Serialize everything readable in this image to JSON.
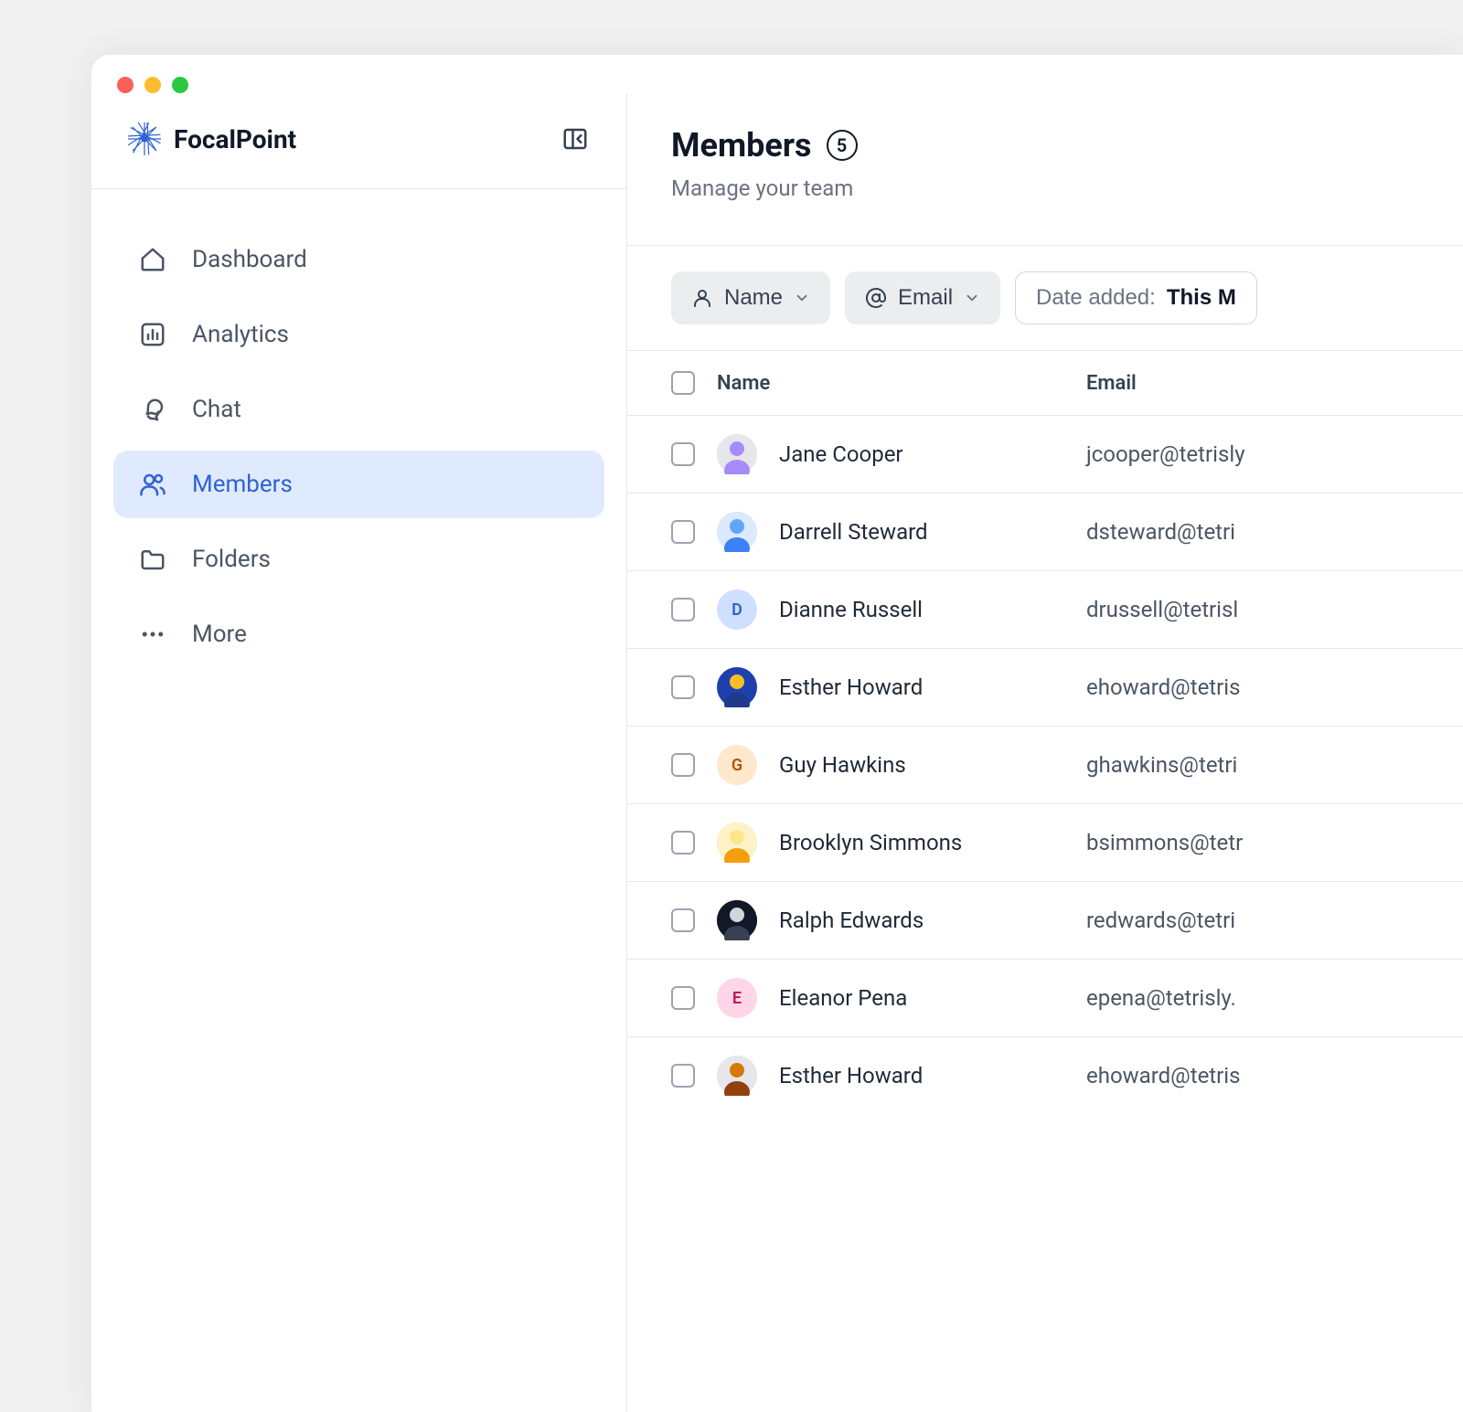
{
  "brand": {
    "name": "FocalPoint"
  },
  "sidebar": {
    "items": [
      {
        "label": "Dashboard"
      },
      {
        "label": "Analytics"
      },
      {
        "label": "Chat"
      },
      {
        "label": "Members"
      },
      {
        "label": "Folders"
      },
      {
        "label": "More"
      }
    ]
  },
  "page": {
    "title": "Members",
    "count": "5",
    "subtitle": "Manage your team"
  },
  "filters": {
    "name": "Name",
    "email": "Email",
    "date_label": "Date added: ",
    "date_value": "This M"
  },
  "columns": {
    "name": "Name",
    "email": "Email"
  },
  "members": [
    {
      "name": "Jane Cooper",
      "email": "jcooper@tetrisly",
      "initial": "",
      "avatar_bg": "#d1d5db",
      "avatar_img": "a1"
    },
    {
      "name": "Darrell Steward",
      "email": "dsteward@tetri",
      "initial": "",
      "avatar_bg": "#d1d5db",
      "avatar_img": "a2"
    },
    {
      "name": "Dianne Russell",
      "email": "drussell@tetrisl",
      "initial": "D",
      "avatar_bg": "#cfe0ff",
      "avatar_color": "#3062d4"
    },
    {
      "name": "Esther Howard",
      "email": "ehoward@tetris",
      "initial": "",
      "avatar_bg": "#d1d5db",
      "avatar_img": "a3"
    },
    {
      "name": "Guy Hawkins",
      "email": "ghawkins@tetri",
      "initial": "G",
      "avatar_bg": "#ffe8cc",
      "avatar_color": "#b45309"
    },
    {
      "name": "Brooklyn Simmons",
      "email": "bsimmons@tetr",
      "initial": "",
      "avatar_bg": "#fbbf24",
      "avatar_img": "a4"
    },
    {
      "name": "Ralph Edwards",
      "email": "redwards@tetri",
      "initial": "",
      "avatar_bg": "#111827",
      "avatar_img": "a5"
    },
    {
      "name": "Eleanor Pena",
      "email": "epena@tetrisly.",
      "initial": "E",
      "avatar_bg": "#ffd6e7",
      "avatar_color": "#be185d"
    },
    {
      "name": "Esther Howard",
      "email": "ehoward@tetris",
      "initial": "",
      "avatar_bg": "#d1d5db",
      "avatar_img": "a6"
    }
  ]
}
